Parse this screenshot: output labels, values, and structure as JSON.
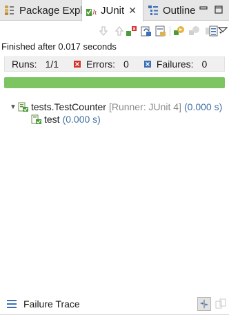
{
  "tabs": {
    "package_explorer": "Package Explor",
    "junit": "JUnit",
    "junit_close": "✕",
    "outline": "Outline"
  },
  "status": "Finished after 0.017 seconds",
  "counters": {
    "runs_label": "Runs:",
    "runs_value": "1/1",
    "errors_label": "Errors:",
    "errors_value": "0",
    "failures_label": "Failures:",
    "failures_value": "0"
  },
  "progress": {
    "fraction": 1.0,
    "color": "#7dc462"
  },
  "tree": {
    "suite": {
      "name": "tests.TestCounter",
      "runner": "[Runner: JUnit 4]",
      "time": "(0.000 s)"
    },
    "test": {
      "name": "test",
      "time": "(0.000 s)"
    }
  },
  "failure_trace": {
    "title": "Failure Trace"
  },
  "colors": {
    "accent_green": "#7dc462",
    "time_blue": "#3f6fa6",
    "error_red": "#d0342c",
    "failure_blue": "#3b6fb6"
  },
  "icons": [
    "package-explorer-icon",
    "junit-icon",
    "outline-icon",
    "minimize-icon",
    "maximize-icon",
    "next-failure-icon",
    "previous-failure-icon",
    "show-failures-only-icon",
    "scroll-lock-icon",
    "test-run-history-icon",
    "rerun-icon",
    "rerun-failed-first-icon",
    "stop-icon",
    "history-dropdown-icon",
    "view-menu-icon",
    "error-icon",
    "failure-icon",
    "test-suite-icon",
    "test-icon",
    "failure-trace-icon",
    "filter-stack-icon",
    "compare-icon"
  ]
}
